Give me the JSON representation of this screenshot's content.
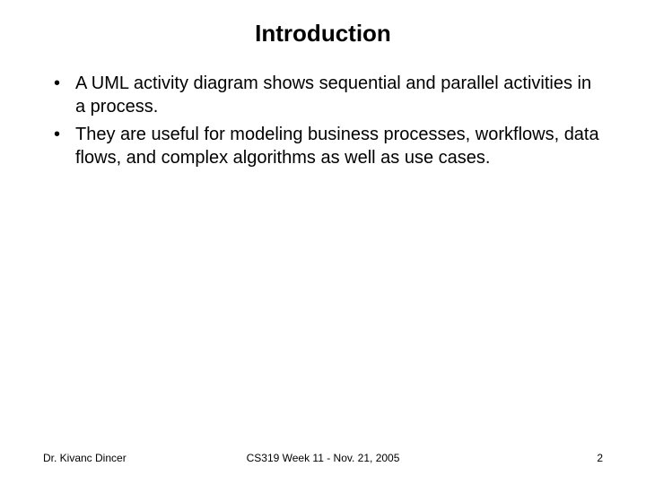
{
  "title": "Introduction",
  "bullets": [
    "A UML activity diagram shows sequential and parallel activities in a process.",
    "They are useful for modeling business processes, workflows, data flows, and complex algorithms as well as use cases."
  ],
  "footer": {
    "left": "Dr. Kivanc Dincer",
    "center": "CS319 Week 11 - Nov. 21, 2005",
    "right": "2"
  }
}
